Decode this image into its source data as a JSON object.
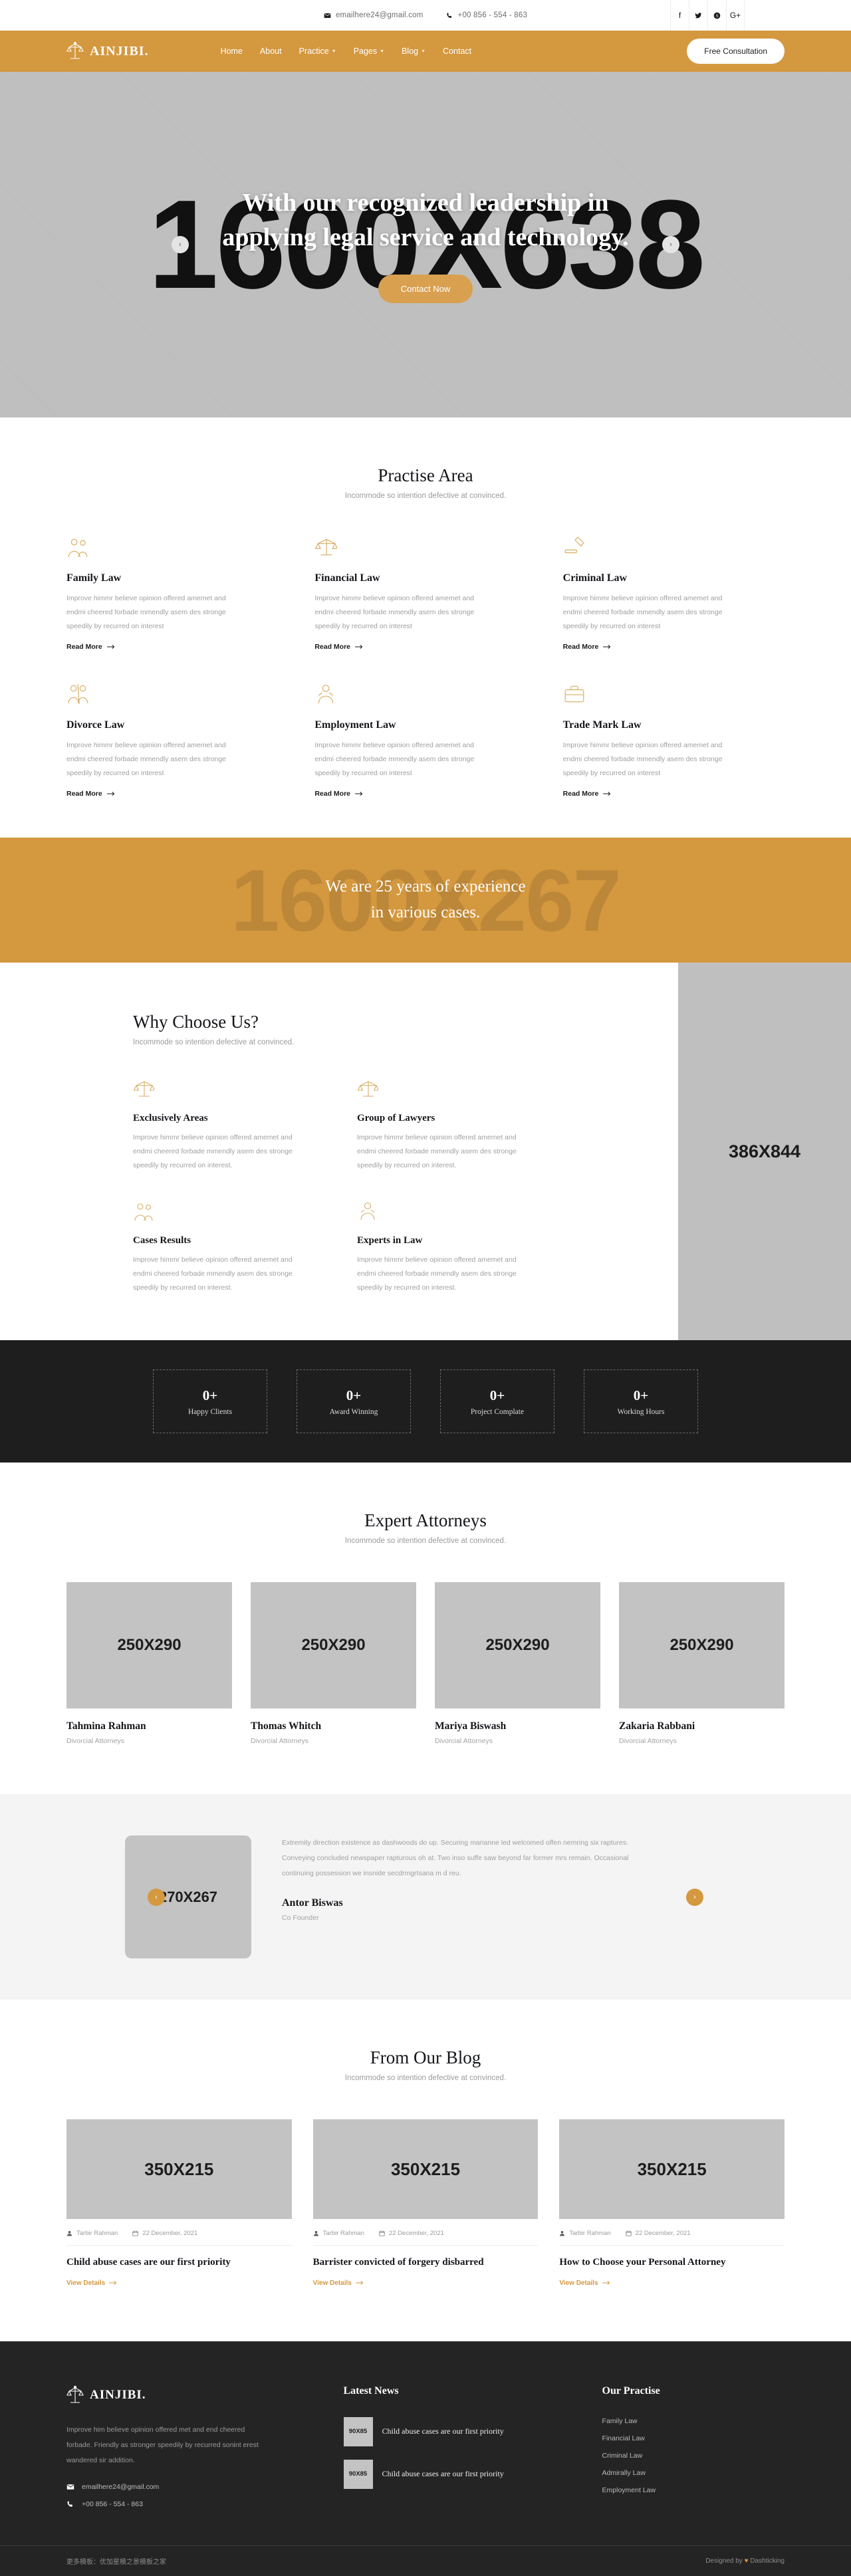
{
  "topbar": {
    "email": "emailhere24@gmail.com",
    "phone": "+00 856 - 554 - 863",
    "socials": [
      {
        "name": "facebook-icon",
        "glyph": "f"
      },
      {
        "name": "twitter-icon",
        "glyph": "ᵛ"
      },
      {
        "name": "skype-icon",
        "glyph": "S"
      },
      {
        "name": "google-plus-icon",
        "glyph": "G+"
      }
    ]
  },
  "nav": {
    "brand": "AINJIBI.",
    "items": [
      {
        "label": "Home",
        "dropdown": false
      },
      {
        "label": "About",
        "dropdown": false
      },
      {
        "label": "Practice",
        "dropdown": true
      },
      {
        "label": "Pages",
        "dropdown": true
      },
      {
        "label": "Blog",
        "dropdown": true
      },
      {
        "label": "Contact",
        "dropdown": false
      }
    ],
    "cta": "Free Consultation",
    "accent": "#d4983f"
  },
  "hero": {
    "placeholder": "1600X638",
    "heading": "With our recognized leadership in applying legal service and technology.",
    "button": "Contact Now",
    "prev": "‹",
    "next": "›"
  },
  "practise": {
    "title": "Practise Area",
    "subtitle": "Incommode so intention defective at convinced.",
    "read_more": "Read More",
    "cards": [
      {
        "icon": "family-icon",
        "title": "Family Law",
        "text": "Improve himmr believe opinion offered amemet and endmi cheered forbade mmendly asem des stronge speedily by recurred on interest"
      },
      {
        "icon": "scales-icon",
        "title": "Financial Law",
        "text": "Improve himmr believe opinion offered amemet and endmi cheered forbade mmendly asem des stronge speedily by recurred on interest"
      },
      {
        "icon": "gavel-icon",
        "title": "Criminal Law",
        "text": "Improve himmr believe opinion offered amemet and endmi cheered forbade mmendly asem des stronge speedily by recurred on interest"
      },
      {
        "icon": "divorce-icon",
        "title": "Divorce Law",
        "text": "Improve himmr believe opinion offered amemet and endmi cheered forbade mmendly asem des stronge speedily by recurred on interest"
      },
      {
        "icon": "employment-icon",
        "title": "Employment Law",
        "text": "Improve himmr believe opinion offered amemet and endmi cheered forbade mmendly asem des stronge speedily by recurred on interest"
      },
      {
        "icon": "briefcase-icon",
        "title": "Trade Mark Law",
        "text": "Improve himmr believe opinion offered amemet and endmi cheered forbade mmendly asem des stronge speedily by recurred on interest"
      }
    ]
  },
  "banner": {
    "placeholder": "1600X267",
    "line1": "We are 25 years of experience",
    "line2": "in various cases."
  },
  "why": {
    "title": "Why Choose Us?",
    "subtitle": "Incommode so intention defective at convinced.",
    "image_placeholder": "386X844",
    "cards": [
      {
        "icon": "scales-icon",
        "title": "Exclusively Areas",
        "text": "Improve himmr believe opinion offered amemet and endmi cheered forbade mmendly asem des stronge speedily by recurred on interest."
      },
      {
        "icon": "scales-icon",
        "title": "Group of Lawyers",
        "text": "Improve himmr believe opinion offered amemet and endmi cheered forbade mmendly asem des stronge speedily by recurred on interest."
      },
      {
        "icon": "family-icon",
        "title": "Cases Results",
        "text": "Improve himmr believe opinion offered amemet and endmi cheered forbade mmendly asem des stronge speedily by recurred on interest."
      },
      {
        "icon": "employment-icon",
        "title": "Experts in Law",
        "text": "Improve himmr believe opinion offered amemet and endmi cheered forbade mmendly asem des stronge speedily by recurred on interest."
      }
    ]
  },
  "counters": [
    {
      "value": "0+",
      "label": "Happy Clients"
    },
    {
      "value": "0+",
      "label": "Award Winning"
    },
    {
      "value": "0+",
      "label": "Project Complate"
    },
    {
      "value": "0+",
      "label": "Working Hours"
    }
  ],
  "attorneys": {
    "title": "Expert Attorneys",
    "subtitle": "Incommode so intention defective at convinced.",
    "members": [
      {
        "placeholder": "250X290",
        "name": "Tahmina Rahman",
        "role": "Divorcial Attorneys"
      },
      {
        "placeholder": "250X290",
        "name": "Thomas Whitch",
        "role": "Divorcial Attorneys"
      },
      {
        "placeholder": "250X290",
        "name": "Mariya Biswash",
        "role": "Divorcial Attorneys"
      },
      {
        "placeholder": "250X290",
        "name": "Zakaria Rabbani",
        "role": "Divorcial Attorneys"
      }
    ]
  },
  "testimonial": {
    "placeholder": "270X267",
    "quote": "Extremity direction existence as dashwoods do up. Securing marianne led welcomed offen nemring six raptures. Conveying concluded newspaper rapturous oh at. Two inso suffe saw beyond far former mrs remain. Occasional continuing possession we insnide secdrmgrtsana m d reu.",
    "name": "Antor Biswas",
    "role": "Co Founder",
    "prev": "‹",
    "next": "›"
  },
  "blog": {
    "title": "From Our Blog",
    "subtitle": "Incommode so intention defective at convinced.",
    "view_details": "View Details",
    "posts": [
      {
        "placeholder": "350X215",
        "author": "Tarbir Rahman",
        "date": "22 December, 2021",
        "title": "Child abuse cases are our first priority"
      },
      {
        "placeholder": "350X215",
        "author": "Tarbir Rahman",
        "date": "22 December, 2021",
        "title": "Barrister convicted of forgery disbarred"
      },
      {
        "placeholder": "350X215",
        "author": "Tarbir Rahman",
        "date": "22 December, 2021",
        "title": "How to Choose your Personal Attorney"
      }
    ]
  },
  "footer": {
    "brand": "AINJIBI.",
    "about": "Improve him believe opinion offered met and end cheered forbade. Friendly as stronger speedily by recurred sonint erest wandered sir addition.",
    "email": "emailhere24@gmail.com",
    "phone": "+00 856 - 554 - 863",
    "news_title": "Latest News",
    "news": [
      {
        "placeholder": "90X85",
        "title": "Child abuse cases are our first priority"
      },
      {
        "placeholder": "90X85",
        "title": "Child abuse cases are our first priority"
      }
    ],
    "practise_title": "Our Practise",
    "practise": [
      "Family Law",
      "Financial Law",
      "Criminal Law",
      "Admirally Law",
      "Employment Law"
    ],
    "copyright": "更多模板：优加星模之景模板之家",
    "credit_pre": "Designed by",
    "credit_post": "Dashticking"
  }
}
